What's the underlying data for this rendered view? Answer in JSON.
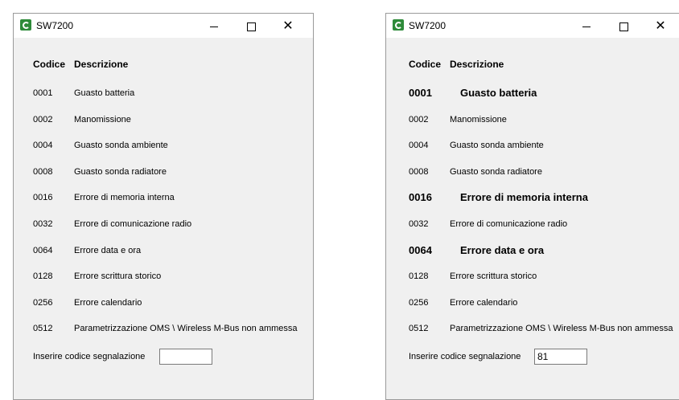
{
  "left_window": {
    "title": "SW7200",
    "header_code": "Codice",
    "header_desc": "Descrizione",
    "rows": [
      {
        "code": "0001",
        "desc": "Guasto batteria"
      },
      {
        "code": "0002",
        "desc": "Manomissione"
      },
      {
        "code": "0004",
        "desc": "Guasto sonda ambiente"
      },
      {
        "code": "0008",
        "desc": "Guasto sonda radiatore"
      },
      {
        "code": "0016",
        "desc": "Errore di memoria interna"
      },
      {
        "code": "0032",
        "desc": "Errore di comunicazione radio"
      },
      {
        "code": "0064",
        "desc": "Errore data e ora"
      },
      {
        "code": "0128",
        "desc": "Errore scrittura storico"
      },
      {
        "code": "0256",
        "desc": "Errore calendario"
      },
      {
        "code": "0512",
        "desc": "Parametrizzazione OMS \\ Wireless M-Bus non ammessa"
      }
    ],
    "input_label": "Inserire codice segnalazione",
    "input_value": ""
  },
  "right_window": {
    "title": "SW7200",
    "header_code": "Codice",
    "header_desc": "Descrizione",
    "rows": [
      {
        "code": "0001",
        "desc": "Guasto batteria",
        "highlighted": true
      },
      {
        "code": "0002",
        "desc": "Manomissione",
        "highlighted": false
      },
      {
        "code": "0004",
        "desc": "Guasto sonda ambiente",
        "highlighted": false
      },
      {
        "code": "0008",
        "desc": "Guasto sonda radiatore",
        "highlighted": false
      },
      {
        "code": "0016",
        "desc": "Errore di memoria interna",
        "highlighted": true
      },
      {
        "code": "0032",
        "desc": "Errore di comunicazione radio",
        "highlighted": false
      },
      {
        "code": "0064",
        "desc": "Errore data e ora",
        "highlighted": true
      },
      {
        "code": "0128",
        "desc": "Errore scrittura storico",
        "highlighted": false
      },
      {
        "code": "0256",
        "desc": "Errore calendario",
        "highlighted": false
      },
      {
        "code": "0512",
        "desc": "Parametrizzazione OMS \\ Wireless M-Bus non ammessa",
        "highlighted": false
      }
    ],
    "input_label": "Inserire codice segnalazione",
    "input_value": "81"
  },
  "icons": {
    "app": "app-logo-icon",
    "minimize": "minimize-icon",
    "maximize": "maximize-icon",
    "close": "close-icon"
  }
}
